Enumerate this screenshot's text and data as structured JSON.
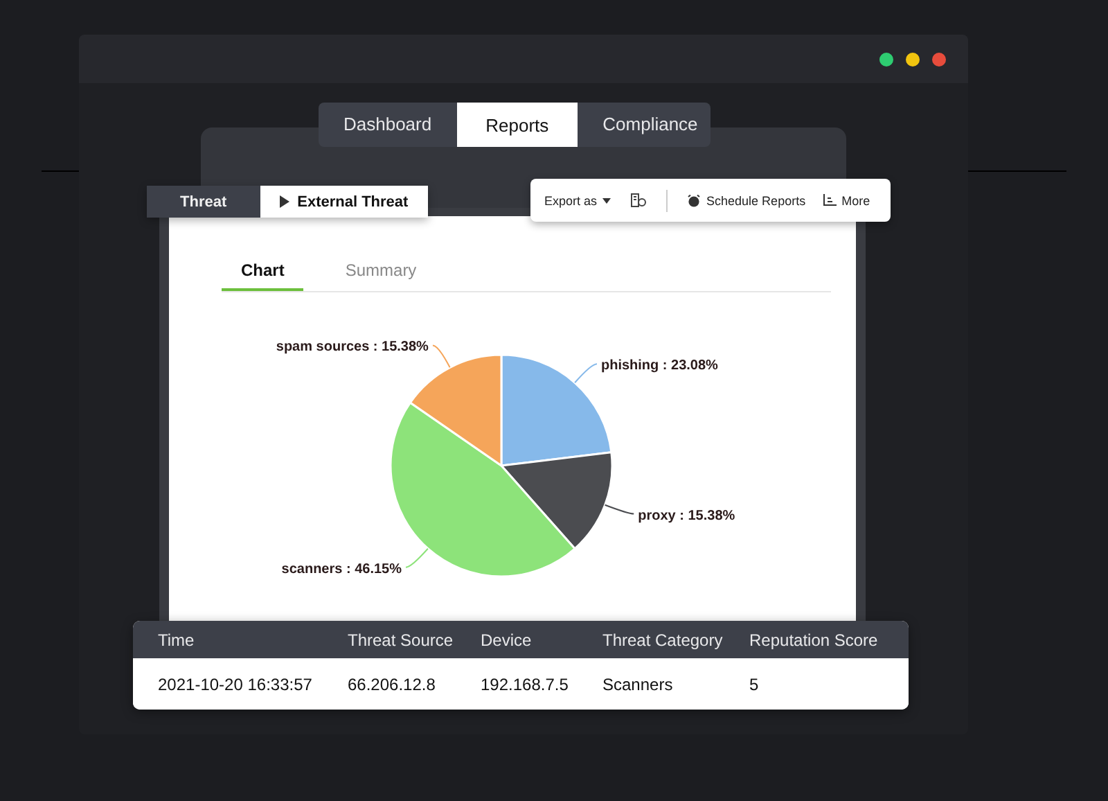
{
  "window": {
    "controls": [
      {
        "color": "#2ecc71"
      },
      {
        "color": "#f1c40f"
      },
      {
        "color": "#e74c3c"
      }
    ]
  },
  "main_tabs": [
    {
      "label": "Dashboard",
      "selected": false
    },
    {
      "label": "Reports",
      "selected": true
    },
    {
      "label": "Compliance",
      "selected": false
    }
  ],
  "threat_switch": [
    {
      "label": "Threat",
      "selected": false,
      "kind": "plain"
    },
    {
      "label": "External Threat",
      "selected": true,
      "kind": "arrow"
    }
  ],
  "toolbar": {
    "export": "Export as",
    "schedule": "Schedule Reports",
    "more": "More"
  },
  "view_tabs": [
    {
      "label": "Chart",
      "selected": true
    },
    {
      "label": "Summary",
      "selected": false
    }
  ],
  "chart_data": {
    "type": "pie",
    "categories": [
      "phishing : 23.08%",
      "proxy : 15.38%",
      "scanners : 46.15%",
      "spam sources : 15.38%"
    ],
    "values": [
      23.08,
      15.38,
      46.15,
      15.38
    ],
    "colors": [
      "#86b9ea",
      "#4b4c50",
      "#8de37a",
      "#f5a55a"
    ]
  },
  "table": {
    "columns": [
      "Time",
      "Threat Source",
      "Device",
      "Threat Category",
      "Reputation Score"
    ],
    "rows": [
      [
        "2021-10-20 16:33:57",
        "66.206.12.8",
        "192.168.7.5",
        "Scanners",
        "5"
      ]
    ]
  }
}
